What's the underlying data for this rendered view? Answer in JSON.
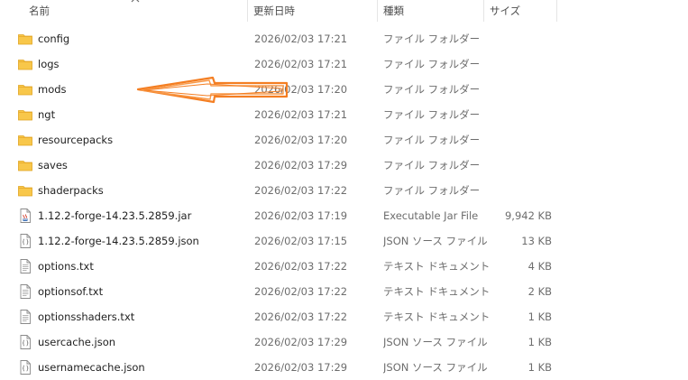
{
  "columns": {
    "name": "名前",
    "date": "更新日時",
    "type": "種類",
    "size": "サイズ"
  },
  "rows": [
    {
      "name": "config",
      "date": "2026/02/03 17:21",
      "type": "ファイル フォルダー",
      "size": "",
      "icon": "folder-icon"
    },
    {
      "name": "logs",
      "date": "2026/02/03 17:21",
      "type": "ファイル フォルダー",
      "size": "",
      "icon": "folder-icon"
    },
    {
      "name": "mods",
      "date": "2026/02/03 17:20",
      "type": "ファイル フォルダー",
      "size": "",
      "icon": "folder-icon"
    },
    {
      "name": "ngt",
      "date": "2026/02/03 17:21",
      "type": "ファイル フォルダー",
      "size": "",
      "icon": "folder-icon"
    },
    {
      "name": "resourcepacks",
      "date": "2026/02/03 17:20",
      "type": "ファイル フォルダー",
      "size": "",
      "icon": "folder-icon"
    },
    {
      "name": "saves",
      "date": "2026/02/03 17:29",
      "type": "ファイル フォルダー",
      "size": "",
      "icon": "folder-icon"
    },
    {
      "name": "shaderpacks",
      "date": "2026/02/03 17:22",
      "type": "ファイル フォルダー",
      "size": "",
      "icon": "folder-icon"
    },
    {
      "name": "1.12.2-forge-14.23.5.2859.jar",
      "date": "2026/02/03 17:19",
      "type": "Executable Jar File",
      "size": "9,942 KB",
      "icon": "jar-file-icon"
    },
    {
      "name": "1.12.2-forge-14.23.5.2859.json",
      "date": "2026/02/03 17:15",
      "type": "JSON ソース ファイル",
      "size": "13 KB",
      "icon": "json-file-icon"
    },
    {
      "name": "options.txt",
      "date": "2026/02/03 17:22",
      "type": "テキスト ドキュメント",
      "size": "4 KB",
      "icon": "text-file-icon"
    },
    {
      "name": "optionsof.txt",
      "date": "2026/02/03 17:22",
      "type": "テキスト ドキュメント",
      "size": "2 KB",
      "icon": "text-file-icon"
    },
    {
      "name": "optionsshaders.txt",
      "date": "2026/02/03 17:22",
      "type": "テキスト ドキュメント",
      "size": "1 KB",
      "icon": "text-file-icon"
    },
    {
      "name": "usercache.json",
      "date": "2026/02/03 17:29",
      "type": "JSON ソース ファイル",
      "size": "1 KB",
      "icon": "json-file-icon"
    },
    {
      "name": "usernamecache.json",
      "date": "2026/02/03 17:29",
      "type": "JSON ソース ファイル",
      "size": "1 KB",
      "icon": "json-file-icon"
    }
  ],
  "colors": {
    "folder": "#f8c74a",
    "folder_dark": "#e7a929",
    "annotation_arrow": "#f47e22"
  }
}
